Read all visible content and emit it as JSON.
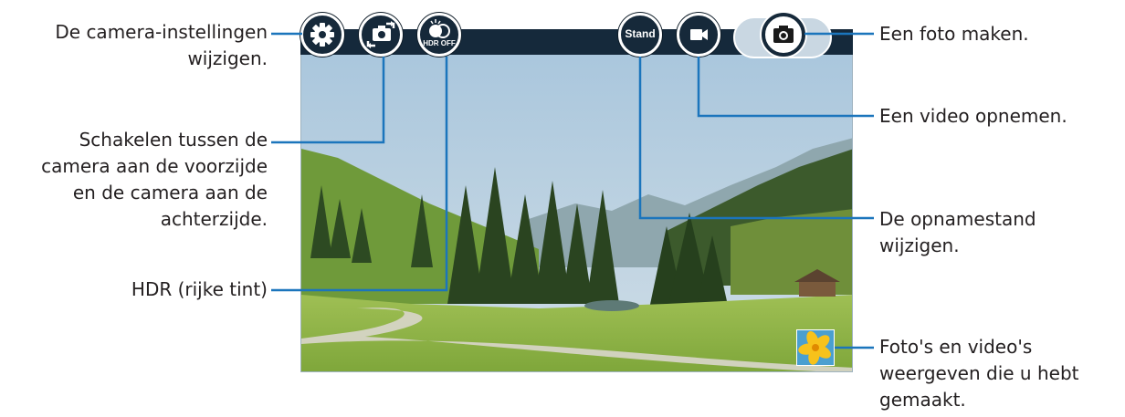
{
  "camera": {
    "buttons": {
      "settings_icon": "gear-icon",
      "switch_icon": "camera-switch-icon",
      "hdr_text": "HDR OFF",
      "mode_text": "Stand",
      "video_icon": "video-camera-icon",
      "photo_icon": "camera-icon"
    },
    "gallery_icon": "flower-thumbnail"
  },
  "callouts": {
    "settings": [
      "De camera-instellingen",
      "wijzigen."
    ],
    "switch": [
      "Schakelen tussen de",
      "camera aan de voorzijde",
      "en de camera aan de",
      "achterzijde."
    ],
    "hdr": [
      "HDR (rijke tint)"
    ],
    "photo": [
      "Een foto maken."
    ],
    "video": [
      "Een video opnemen."
    ],
    "mode": [
      "De opnamestand",
      "wijzigen."
    ],
    "gallery": [
      "Foto's en video's",
      "weergeven die u hebt",
      "gemaakt."
    ]
  },
  "colors": {
    "accent": "#1b75bc",
    "button_bg": "#16293a",
    "bar": "#15293b"
  }
}
